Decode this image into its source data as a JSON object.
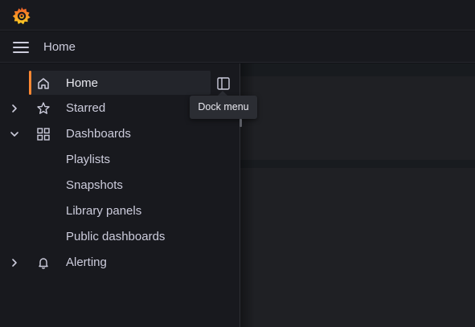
{
  "header": {
    "breadcrumb": "Home"
  },
  "sidebar": {
    "items": [
      {
        "label": "Home",
        "icon": "home-icon",
        "active": true,
        "expandable": false
      },
      {
        "label": "Starred",
        "icon": "star-icon",
        "expandable": true,
        "expanded": false
      },
      {
        "label": "Dashboards",
        "icon": "apps-icon",
        "expandable": true,
        "expanded": true,
        "children": [
          "Playlists",
          "Snapshots",
          "Library panels",
          "Public dashboards"
        ]
      },
      {
        "label": "Alerting",
        "icon": "bell-icon",
        "expandable": true,
        "expanded": false
      }
    ],
    "dock_tooltip": "Dock menu"
  },
  "colors": {
    "accent": "#ff8833",
    "background": "#111217",
    "sidebar": "#18191e",
    "text": "#ccccdc"
  }
}
